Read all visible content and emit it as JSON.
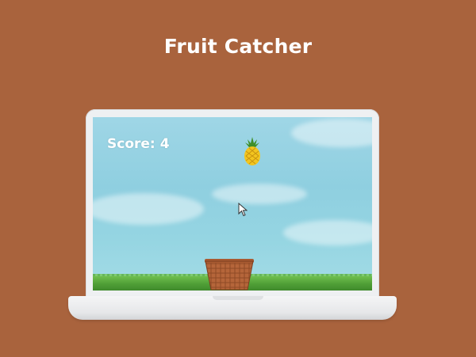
{
  "page": {
    "title": "Fruit Catcher"
  },
  "game": {
    "score_label": "Score:",
    "score_value": "4",
    "falling_fruit": "pineapple",
    "catcher": "basket"
  },
  "icons": {
    "fruit": "pineapple-icon",
    "catcher": "basket-icon",
    "cursor": "mouse-pointer-icon"
  },
  "colors": {
    "background": "#a9633d",
    "sky": "#95d5e2",
    "grass": "#4f9e36",
    "basket": "#b5653a",
    "text": "#ffffff"
  }
}
